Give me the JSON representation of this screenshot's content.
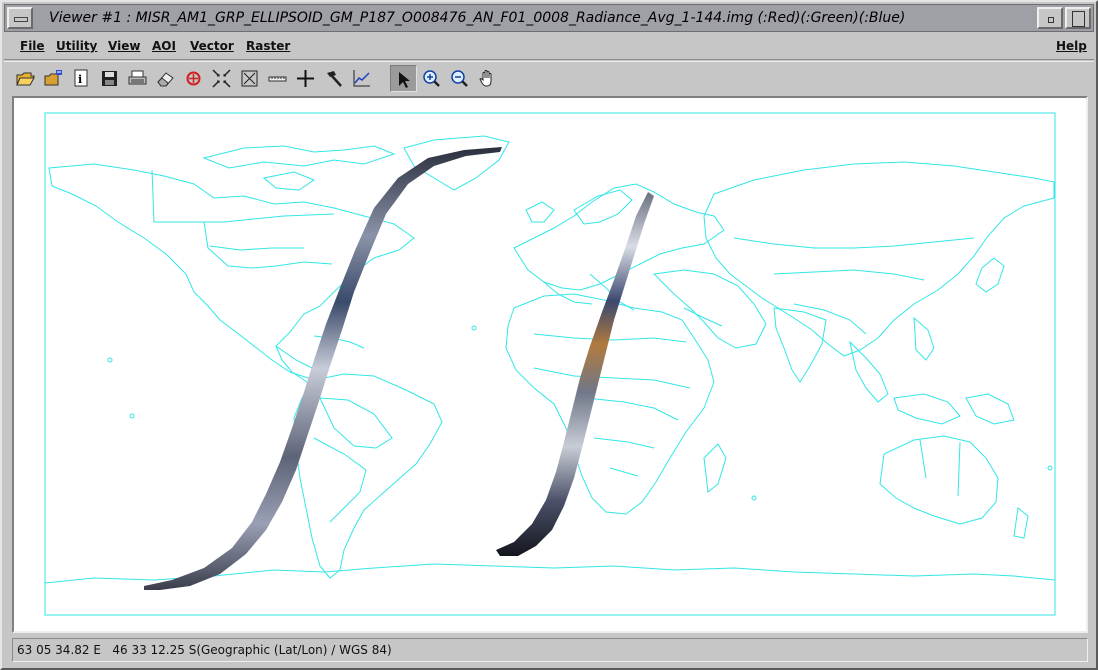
{
  "window": {
    "title": "Viewer #1 : MISR_AM1_GRP_ELLIPSOID_GM_P187_O008476_AN_F01_0008_Radiance_Avg_1-144.img (:Red)(:Green)(:Blue)"
  },
  "menubar": {
    "items": [
      {
        "label": "File"
      },
      {
        "label": "Utility"
      },
      {
        "label": "View"
      },
      {
        "label": "AOI"
      },
      {
        "label": "Vector"
      },
      {
        "label": "Raster"
      }
    ],
    "help": "Help"
  },
  "toolbar": {
    "tools": [
      "open-folder-icon",
      "open-layer-icon",
      "info-icon",
      "save-icon",
      "print-icon",
      "eraser-icon",
      "clear-view-icon",
      "zoom-to-fit-icon",
      "full-extent-icon",
      "measure-ruler-icon",
      "crosshair-icon",
      "hammer-icon",
      "profile-chart-icon",
      "select-pointer-icon",
      "zoom-in-icon",
      "zoom-out-icon",
      "pan-hand-icon"
    ],
    "active_tool": "select-pointer-icon"
  },
  "colors": {
    "map_lines": "#33e6e6",
    "window_bg": "#c6c6c6",
    "titlebar_bg": "#9f9fa6"
  },
  "status": {
    "coordinates": "63 05 34.82 E   46 33 12.25 S(Geographic (Lat/Lon) / WGS 84)"
  }
}
